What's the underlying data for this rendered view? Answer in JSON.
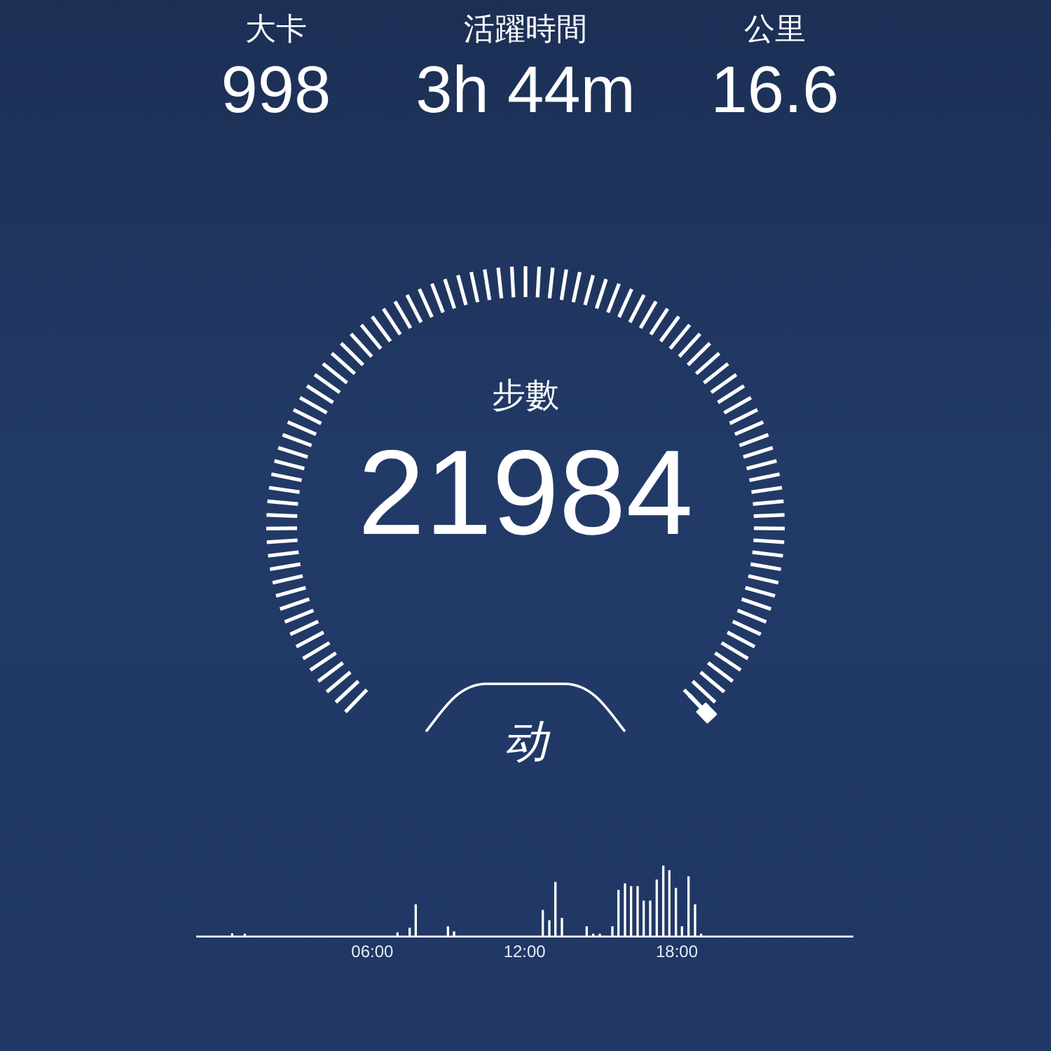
{
  "stats": [
    {
      "label": "大卡",
      "value": "998"
    },
    {
      "label": "活躍時間",
      "value": "3h 44m"
    },
    {
      "label": "公里",
      "value": "16.6"
    }
  ],
  "gauge": {
    "label": "步數",
    "value": "21984"
  },
  "logo": {
    "text": "动"
  },
  "activity": {
    "kind": "picture",
    "time_labels": [
      "06:00",
      "12:00",
      "18:00"
    ]
  }
}
